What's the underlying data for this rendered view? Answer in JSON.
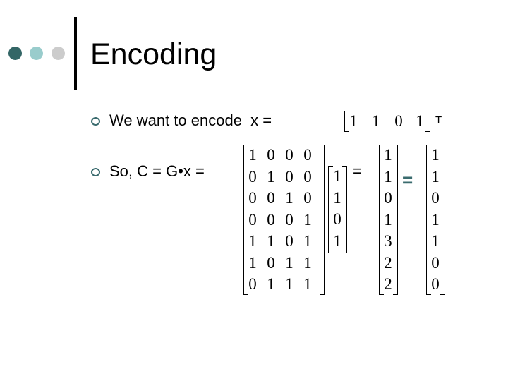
{
  "slide": {
    "title": "Encoding",
    "decor_dots": [
      {
        "name": "dark-teal",
        "color": "#336666"
      },
      {
        "name": "light-teal",
        "color": "#99CCCC"
      },
      {
        "name": "gray",
        "color": "#CCCCCC"
      }
    ],
    "bullet_color": "#3a6b6e",
    "bullets": [
      {
        "text": "We want to encode  x ="
      },
      {
        "text": "So, C = G•x ="
      }
    ],
    "x_vector": {
      "values": [
        "1",
        "1",
        "0",
        "1"
      ],
      "superscript": "T"
    },
    "generator_matrix": {
      "rows": [
        [
          "1",
          "0",
          "0",
          "0"
        ],
        [
          "0",
          "1",
          "0",
          "0"
        ],
        [
          "0",
          "0",
          "1",
          "0"
        ],
        [
          "0",
          "0",
          "0",
          "1"
        ],
        [
          "1",
          "1",
          "0",
          "1"
        ],
        [
          "1",
          "0",
          "1",
          "1"
        ],
        [
          "0",
          "1",
          "1",
          "1"
        ]
      ]
    },
    "x_column": [
      "1",
      "1",
      "0",
      "1"
    ],
    "equals_1": "=",
    "product_column": [
      "1",
      "1",
      "0",
      "1",
      "3",
      "2",
      "2"
    ],
    "equals_2": "=",
    "result_column": [
      "1",
      "1",
      "0",
      "1",
      "1",
      "0",
      "0"
    ]
  }
}
